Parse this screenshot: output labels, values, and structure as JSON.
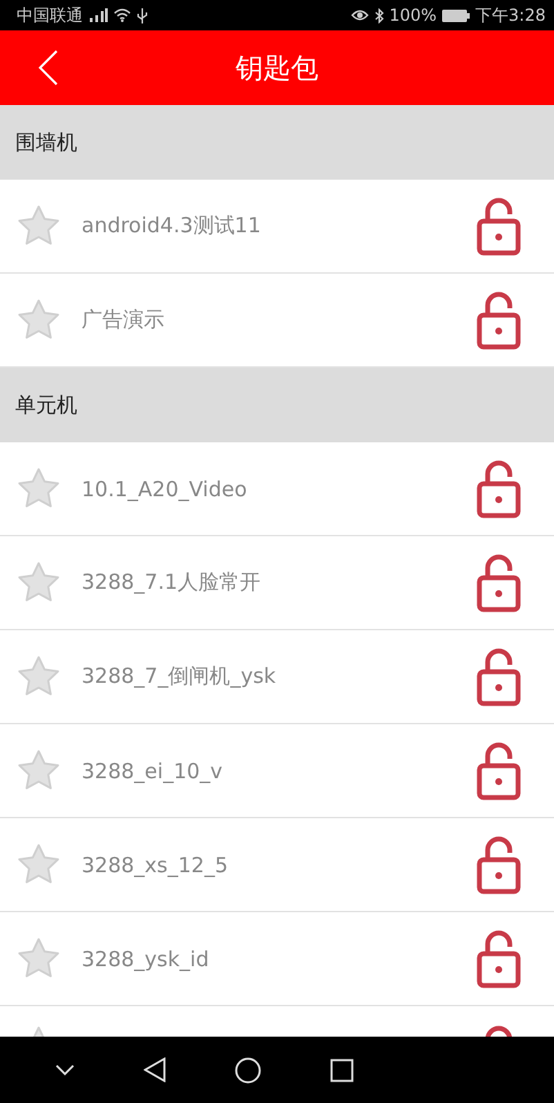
{
  "status_bar": {
    "carrier": "中国联通",
    "battery": "100%",
    "time": "下午3:28"
  },
  "header": {
    "title": "钥匙包"
  },
  "sections": [
    {
      "title": "围墙机",
      "items": [
        {
          "name": "android4.3测试11"
        },
        {
          "name": "广告演示"
        }
      ]
    },
    {
      "title": "单元机",
      "items": [
        {
          "name": "10.1_A20_Video"
        },
        {
          "name": "3288_7.1人脸常开"
        },
        {
          "name": "3288_7_倒闸机_ysk"
        },
        {
          "name": "3288_ei_10_v"
        },
        {
          "name": "3288_xs_12_5"
        },
        {
          "name": "3288_ysk_id"
        }
      ]
    }
  ]
}
